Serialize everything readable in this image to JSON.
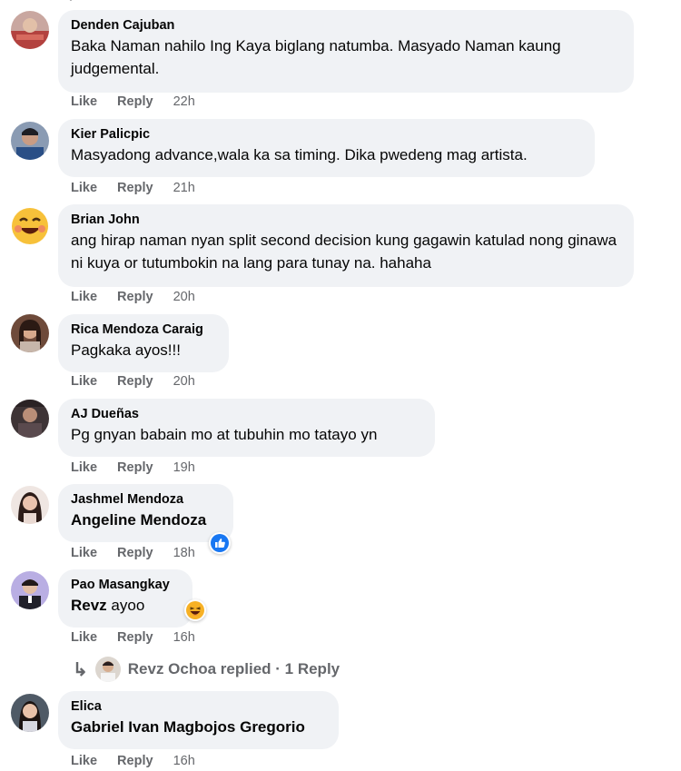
{
  "top_fragment": "·",
  "actions": {
    "like": "Like",
    "reply": "Reply"
  },
  "comments": [
    {
      "author": "Denden Cajuban",
      "text": "Baka Naman nahilo Ing Kaya biglang natumba. Masyado Naman kaung judgemental.",
      "time": "22h"
    },
    {
      "author": "Kier Palicpic",
      "text": "Masyadong advance,wala ka sa timing. Dika pwedeng mag artista.",
      "time": "21h"
    },
    {
      "author": "Brian John",
      "text": "ang hirap naman nyan split second decision kung gagawin katulad nong ginawa ni kuya or tutumbokin na lang para tunay na. hahaha",
      "time": "20h"
    },
    {
      "author": "Rica Mendoza Caraig",
      "text": "Pagkaka ayos!!!",
      "time": "20h"
    },
    {
      "author": "AJ Dueñas",
      "text": "Pg gnyan babain mo at tubuhin mo tatayo yn",
      "time": "19h"
    },
    {
      "author": "Jashmel Mendoza",
      "mention": "Angeline Mendoza",
      "time": "18h",
      "reaction": "like"
    },
    {
      "author": "Pao Masangkay",
      "mention": "Revz",
      "text": " ayoo",
      "time": "16h",
      "reaction": "haha"
    },
    {
      "author": "Elica",
      "mention": "Gabriel Ivan Magbojos Gregorio",
      "time": "16h"
    }
  ],
  "replies_link": {
    "name": "Revz Ochoa",
    "label": "Revz Ochoa replied · 1 Reply"
  },
  "colors": {
    "bubble": "#f0f2f5",
    "meta": "#65676b",
    "like_blue": "#1877f2",
    "haha_yellow": "#f7b125"
  }
}
